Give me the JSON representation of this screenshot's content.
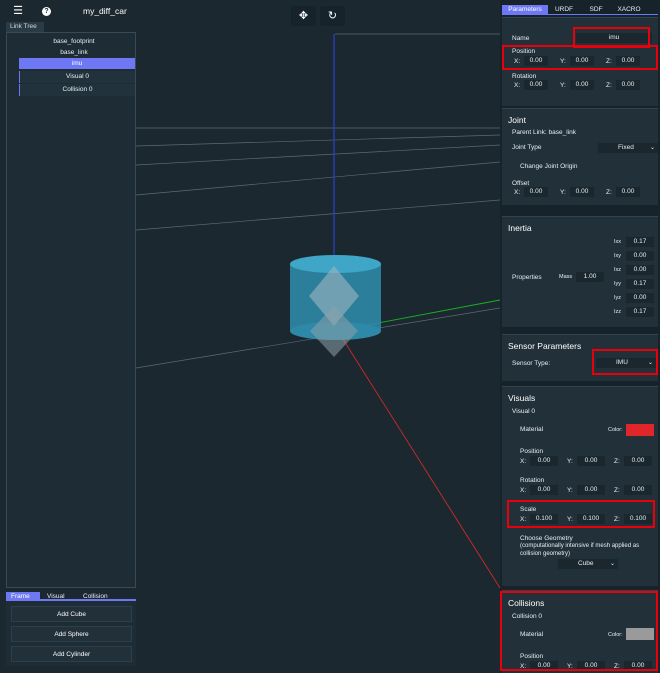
{
  "app": {
    "title": "my_diff_car",
    "menu_icon": "menu-icon",
    "help_icon": "help-icon",
    "help_glyph": "?"
  },
  "toolbar": {
    "move_icon": "move-icon",
    "rotate_icon": "rotate-icon"
  },
  "link_tree": {
    "tab_label": "Link Tree",
    "items": [
      "base_footprint",
      "base_link",
      "imu"
    ],
    "sub_items": [
      "Visual 0",
      "Collision 0"
    ]
  },
  "bottom_left": {
    "tabs": [
      "Frame",
      "Visual",
      "Collision"
    ],
    "buttons": [
      "Add Cube",
      "Add Sphere",
      "Add Cylinder"
    ]
  },
  "right_panel": {
    "tabs": [
      "Parameters",
      "URDF",
      "SDF",
      "XACRO"
    ],
    "link": {
      "name_label": "Name",
      "name_value": "imu",
      "position_label": "Position",
      "position": {
        "x": "0.00",
        "y": "0.00",
        "z": "0.00"
      },
      "rotation_label": "Rotation",
      "rotation": {
        "x": "0.00",
        "y": "0.00",
        "z": "0.00"
      }
    },
    "joint": {
      "title": "Joint",
      "parent_link": "Parent Link: base_link",
      "type_label": "Joint Type",
      "type_value": "Fixed",
      "change_origin": "Change Joint Origin",
      "offset_label": "Offset",
      "offset": {
        "x": "0.00",
        "y": "0.00",
        "z": "0.00"
      }
    },
    "inertia": {
      "title": "Inertia",
      "properties_label": "Properties",
      "mass_label": "Mass",
      "mass_value": "1.00",
      "components": [
        {
          "label": "Ixx",
          "value": "0.17"
        },
        {
          "label": "Ixy",
          "value": "0.00"
        },
        {
          "label": "Ixz",
          "value": "0.00"
        },
        {
          "label": "Iyy",
          "value": "0.17"
        },
        {
          "label": "Iyz",
          "value": "0.00"
        },
        {
          "label": "Izz",
          "value": "0.17"
        }
      ]
    },
    "sensor": {
      "title": "Sensor Parameters",
      "type_label": "Sensor Type:",
      "type_value": "IMU"
    },
    "visuals": {
      "title": "Visuals",
      "item": "Visual 0",
      "material_label": "Material",
      "color_label": "Color:",
      "color": "#e0252b",
      "position_label": "Position",
      "position": {
        "x": "0.00",
        "y": "0.00",
        "z": "0.00"
      },
      "rotation_label": "Rotation",
      "rotation": {
        "x": "0.00",
        "y": "0.00",
        "z": "0.00"
      },
      "scale_label": "Scale",
      "scale": {
        "x": "0.100",
        "y": "0.100",
        "z": "0.100"
      },
      "geometry_label": "Choose Geometry",
      "geometry_note": "(computationally intensive if mesh applied as collision geometry)",
      "geometry_value": "Cube"
    },
    "collisions": {
      "title": "Collisions",
      "item": "Collision 0",
      "material_label": "Material",
      "color_label": "Color:",
      "color": "#9a9a9a",
      "position_label": "Position",
      "position": {
        "x": "0.00",
        "y": "0.00",
        "z": "0.00"
      }
    },
    "axis_labels": {
      "x": "X:",
      "y": "Y:",
      "z": "Z:"
    }
  },
  "colors": {
    "accent": "#6e78f5",
    "highlight": "#e8000b",
    "z_axis": "#2a3fd0",
    "y_axis": "#1bb324",
    "x_axis": "#cc2a2a",
    "cylinder": "#3ba3c5"
  }
}
